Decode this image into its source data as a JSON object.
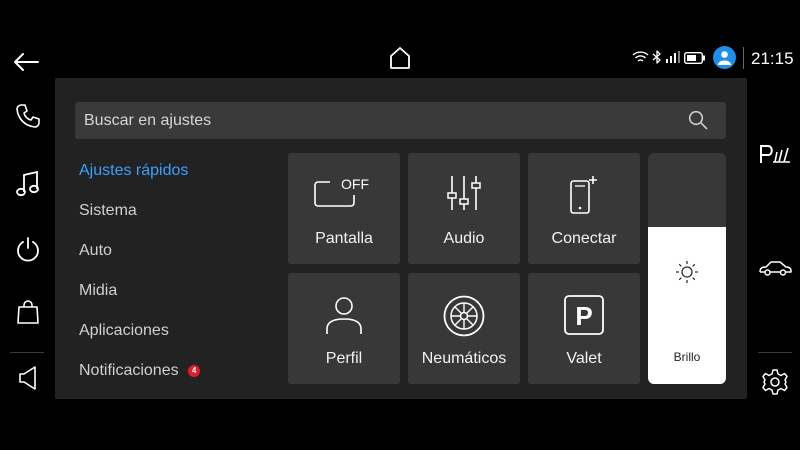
{
  "left_nav": {
    "items": [
      {
        "icon": "back-arrow-icon"
      },
      {
        "icon": "phone-icon"
      },
      {
        "icon": "music-note-icon"
      },
      {
        "icon": "power-icon"
      },
      {
        "icon": "shopping-bag-icon"
      },
      {
        "icon": "volume-icon"
      }
    ]
  },
  "top_bar": {
    "home_icon": "home-icon",
    "status_icons": [
      "wifi-icon",
      "bluetooth-icon",
      "signal-icon",
      "battery-icon"
    ],
    "profile_icon": "user-avatar-icon",
    "time": "21:15"
  },
  "right_nav": {
    "items": [
      {
        "icon": "park-assist-icon"
      },
      {
        "icon": "car-icon"
      },
      {
        "icon": "gear-icon"
      }
    ]
  },
  "search": {
    "placeholder": "Buscar en ajustes",
    "icon": "search-icon"
  },
  "menu": {
    "items": [
      {
        "label": "Ajustes rápidos",
        "active": true
      },
      {
        "label": "Sistema",
        "active": false
      },
      {
        "label": "Auto",
        "active": false
      },
      {
        "label": "Midia",
        "active": false
      },
      {
        "label": "Aplicaciones",
        "active": false
      },
      {
        "label": "Notificaciones",
        "active": false,
        "badge": "4"
      }
    ]
  },
  "tiles": [
    {
      "label": "Pantalla",
      "icon": "display-off-icon",
      "icon_text": "OFF"
    },
    {
      "label": "Audio",
      "icon": "equalizer-icon"
    },
    {
      "label": "Conectar",
      "icon": "phone-connect-icon"
    },
    {
      "label": "Perfil",
      "icon": "profile-icon"
    },
    {
      "label": "Neumáticos",
      "icon": "tire-icon"
    },
    {
      "label": "Valet",
      "icon": "valet-parking-icon",
      "icon_text": "P"
    }
  ],
  "brightness": {
    "label": "Brillo",
    "icon": "brightness-icon",
    "level_fraction": 0.68
  },
  "colors": {
    "accent": "#3aa0ff",
    "panel": "#222222",
    "tile": "#383838",
    "badge": "#e31b2b",
    "avatar": "#1e8ee8"
  }
}
